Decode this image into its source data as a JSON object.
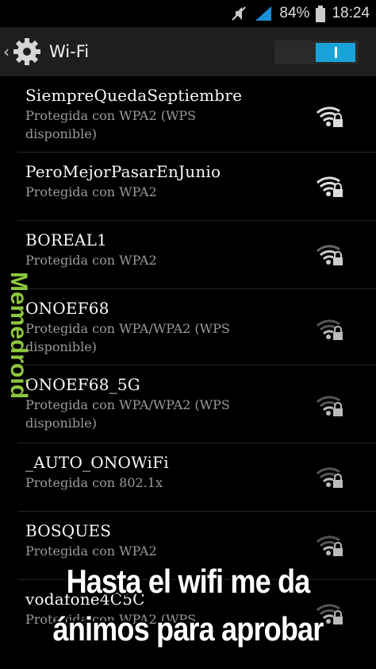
{
  "status_bar": {
    "battery_percent": "84%",
    "time": "18:24"
  },
  "header": {
    "title": "Wi-Fi",
    "wifi_toggle_on": true
  },
  "networks": [
    {
      "name": "SiempreQuedaSeptiembre",
      "security": "Protegida con WPA2 (WPS disponible)"
    },
    {
      "name": "PeroMejorPasarEnJunio",
      "security": "Protegida con WPA2"
    },
    {
      "name": "BOREAL1",
      "security": "Protegida con WPA2"
    },
    {
      "name": "ONOEF68",
      "security": "Protegida con WPA/WPA2 (WPS disponible)"
    },
    {
      "name": "ONOEF68_5G",
      "security": "Protegida con WPA/WPA2 (WPS disponible)"
    },
    {
      "name": "_AUTO_ONOWiFi",
      "security": "Protegida con 802.1x"
    },
    {
      "name": "BOSQUES",
      "security": "Protegida con WPA2"
    },
    {
      "name": "vodafone4C5C",
      "security": "Protegida con WPA2 (WPS"
    }
  ],
  "watermark": {
    "text": "Memedroid",
    "color": "#8dc63f"
  },
  "caption": {
    "line1": "Hasta el wifi me da",
    "line2": "ánimos para aprobar"
  },
  "colors": {
    "accent": "#1aa3d8",
    "background": "#000000",
    "header": "#1e1e1e"
  }
}
